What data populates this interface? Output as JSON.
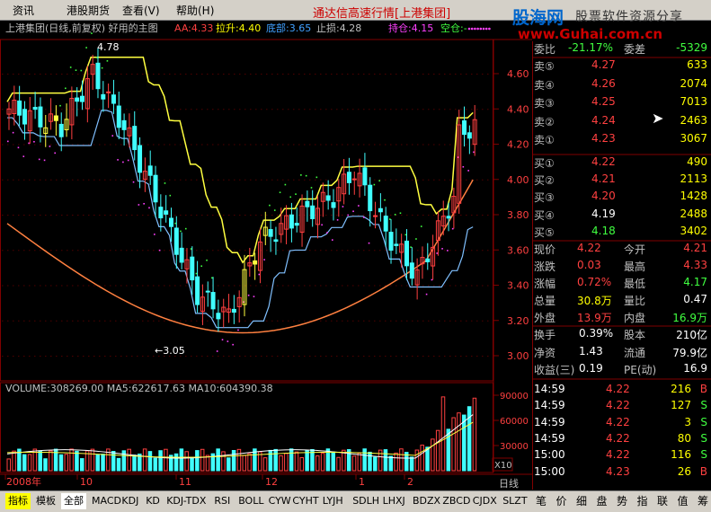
{
  "menu": {
    "items": [
      "资讯",
      "港股期货",
      "查看(V)",
      "帮助(H)"
    ],
    "banner": "通达信高速行情[上港集团]"
  },
  "logo": {
    "line1": "股海网",
    "line2": "股票软件资源分享",
    "line3": "www.Guhai.com.cn"
  },
  "chart": {
    "header": "上港集团(日线,前复权) 好用的主图",
    "indicators": [
      {
        "label": "AA:4.33",
        "color": "#ff4040"
      },
      {
        "label": "拉升:4.40",
        "color": "#ffff00"
      },
      {
        "label": "底部:3.65",
        "color": "#40a0ff"
      },
      {
        "label": "止损:4.28",
        "color": "#c0c0c0"
      },
      {
        "label": "持仓:4.15",
        "color": "#ff40ff"
      },
      {
        "label": "空仓:-",
        "color": "#40ff40"
      }
    ],
    "price_axis": [
      "4.60",
      "4.40",
      "4.20",
      "4.00",
      "3.80",
      "3.60",
      "3.40",
      "3.20",
      "3.00"
    ],
    "high_marker": "4.78",
    "low_marker": "←3.05",
    "volume_header": "VOLUME:308269.00  MA5:622617.63  MA10:604390.38",
    "volume_axis": [
      "90000",
      "60000",
      "30000"
    ],
    "volume_unit": "X10",
    "date_labels": [
      "2008年",
      "10",
      "11",
      "12",
      "1",
      "2"
    ],
    "period": "日线"
  },
  "quote": {
    "top": {
      "label": "委比",
      "value": "-21.17%",
      "label2": "委差",
      "value2": "-5329"
    },
    "asks": [
      {
        "label": "卖⑤",
        "price": "4.27",
        "volume": "633"
      },
      {
        "label": "卖④",
        "price": "4.26",
        "volume": "2074"
      },
      {
        "label": "卖③",
        "price": "4.25",
        "volume": "7013"
      },
      {
        "label": "卖②",
        "price": "4.24",
        "volume": "2463"
      },
      {
        "label": "卖①",
        "price": "4.23",
        "volume": "3067"
      }
    ],
    "bids": [
      {
        "label": "买①",
        "price": "4.22",
        "volume": "490",
        "pcolor": "#ff4040"
      },
      {
        "label": "买②",
        "price": "4.21",
        "volume": "2113",
        "pcolor": "#ff4040"
      },
      {
        "label": "买③",
        "price": "4.20",
        "volume": "1428",
        "pcolor": "#ff4040"
      },
      {
        "label": "买④",
        "price": "4.19",
        "volume": "2488",
        "pcolor": "#ffffff"
      },
      {
        "label": "买⑤",
        "price": "4.18",
        "volume": "3402",
        "pcolor": "#40ff40"
      }
    ],
    "stats": [
      {
        "l1": "现价",
        "v1": "4.22",
        "c1": "#ff4040",
        "l2": "今开",
        "v2": "4.21",
        "c2": "#ff4040"
      },
      {
        "l1": "涨跌",
        "v1": "0.03",
        "c1": "#ff4040",
        "l2": "最高",
        "v2": "4.33",
        "c2": "#ff4040"
      },
      {
        "l1": "涨幅",
        "v1": "0.72%",
        "c1": "#ff4040",
        "l2": "最低",
        "v2": "4.17",
        "c2": "#40ff40"
      },
      {
        "l1": "总量",
        "v1": "30.8万",
        "c1": "#ffff00",
        "l2": "量比",
        "v2": "0.47",
        "c2": "#ffffff"
      },
      {
        "l1": "外盘",
        "v1": "13.9万",
        "c1": "#ff4040",
        "l2": "内盘",
        "v2": "16.9万",
        "c2": "#40ff40"
      }
    ],
    "stats2": [
      {
        "l1": "换手",
        "v1": "0.39%",
        "l2": "股本",
        "v2": "210亿"
      },
      {
        "l1": "净资",
        "v1": "1.43",
        "l2": "流通",
        "v2": "79.9亿"
      },
      {
        "l1": "收益(三)",
        "v1": "0.19",
        "l2": "PE(动)",
        "v2": "16.9"
      }
    ],
    "ticks": [
      {
        "time": "14:59",
        "price": "4.22",
        "vol": "216",
        "side": "B",
        "scolor": "#ff4040"
      },
      {
        "time": "14:59",
        "price": "4.22",
        "vol": "127",
        "side": "S",
        "scolor": "#40ff40"
      },
      {
        "time": "14:59",
        "price": "4.22",
        "vol": "3",
        "side": "S",
        "scolor": "#40ff40"
      },
      {
        "time": "14:59",
        "price": "4.22",
        "vol": "80",
        "side": "S",
        "scolor": "#40ff40"
      },
      {
        "time": "15:00",
        "price": "4.22",
        "vol": "116",
        "side": "S",
        "scolor": "#40ff40"
      },
      {
        "time": "15:00",
        "price": "4.23",
        "vol": "26",
        "side": "B",
        "scolor": "#ff4040"
      }
    ]
  },
  "bottom_tabs": [
    "指标",
    "模板",
    "全部",
    "MACD",
    "KDJ",
    "KD",
    "KDJ-TDX",
    "RSI",
    "BOLL",
    "CYW",
    "CYHT",
    "LYJH",
    "SDLH",
    "LHXJ",
    "BDZX",
    "ZBCD",
    "CJDX",
    "SLZT"
  ],
  "right_tabs": [
    "笔",
    "价",
    "细",
    "盘",
    "势",
    "指",
    "联",
    "值",
    "筹"
  ],
  "colors": {
    "up": "#ff4040",
    "down": "#40ff40",
    "bg": "#000000",
    "grid": "#800000"
  }
}
